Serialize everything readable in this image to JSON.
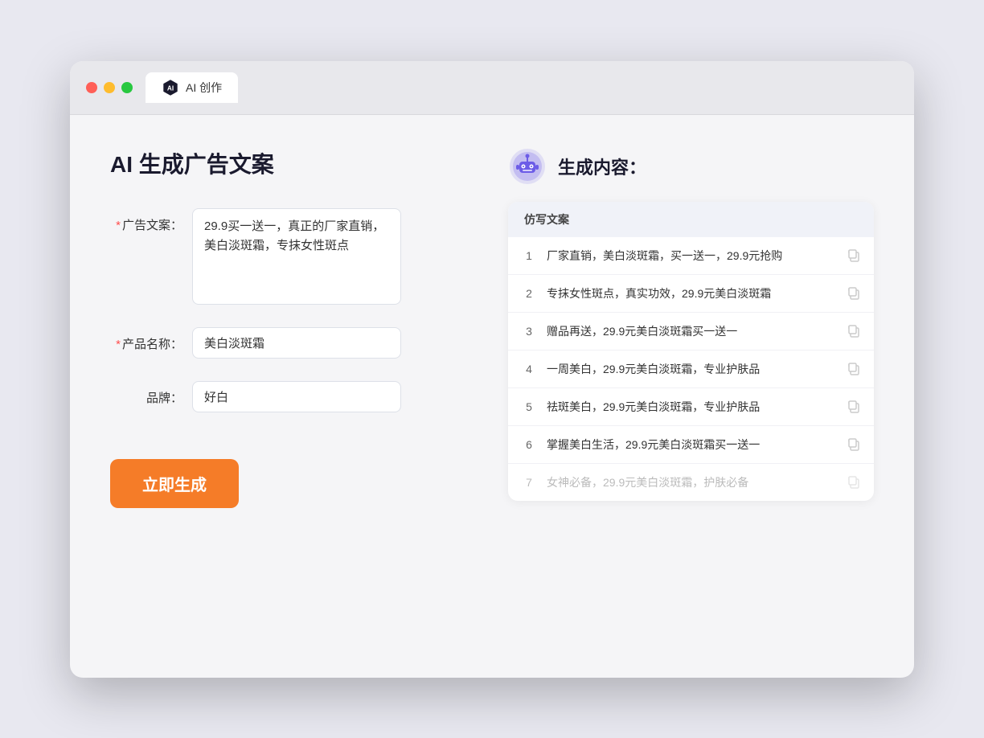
{
  "window": {
    "tab_label": "AI 创作"
  },
  "left": {
    "title": "AI 生成广告文案",
    "fields": {
      "ad_copy": {
        "label": "广告文案：",
        "required": true,
        "value": "29.9买一送一，真正的厂家直销，美白淡斑霜，专抹女性斑点",
        "placeholder": ""
      },
      "product_name": {
        "label": "产品名称：",
        "required": true,
        "value": "美白淡斑霜",
        "placeholder": ""
      },
      "brand": {
        "label": "品牌：",
        "required": false,
        "value": "好白",
        "placeholder": ""
      }
    },
    "button_label": "立即生成"
  },
  "right": {
    "title": "生成内容：",
    "table_header": "仿写文案",
    "rows": [
      {
        "num": "1",
        "text": "厂家直销，美白淡斑霜，买一送一，29.9元抢购",
        "muted": false
      },
      {
        "num": "2",
        "text": "专抹女性斑点，真实功效，29.9元美白淡斑霜",
        "muted": false
      },
      {
        "num": "3",
        "text": "赠品再送，29.9元美白淡斑霜买一送一",
        "muted": false
      },
      {
        "num": "4",
        "text": "一周美白，29.9元美白淡斑霜，专业护肤品",
        "muted": false
      },
      {
        "num": "5",
        "text": "祛斑美白，29.9元美白淡斑霜，专业护肤品",
        "muted": false
      },
      {
        "num": "6",
        "text": "掌握美白生活，29.9元美白淡斑霜买一送一",
        "muted": false
      },
      {
        "num": "7",
        "text": "女神必备，29.9元美白淡斑霜，护肤必备",
        "muted": true
      }
    ]
  }
}
